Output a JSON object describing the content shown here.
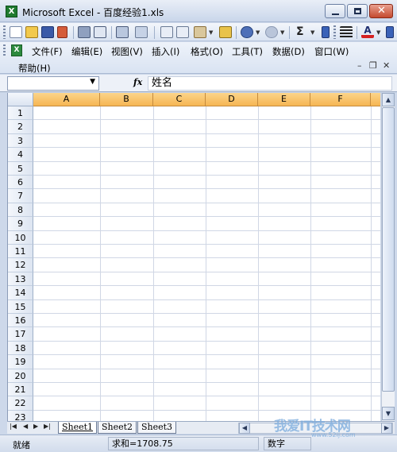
{
  "window": {
    "title": "Microsoft Excel - 百度经验1.xls",
    "app_icon_glyph": "X"
  },
  "menu": {
    "items": [
      {
        "label": "文件(F)"
      },
      {
        "label": "编辑(E)"
      },
      {
        "label": "视图(V)"
      },
      {
        "label": "插入(I)"
      },
      {
        "label": "格式(O)"
      },
      {
        "label": "工具(T)"
      },
      {
        "label": "数据(D)"
      },
      {
        "label": "窗口(W)"
      }
    ],
    "help": "帮助(H)"
  },
  "formula_bar": {
    "name_box": "",
    "fx_label": "fx",
    "content": "姓名"
  },
  "grid": {
    "columns": [
      "A",
      "B",
      "C",
      "D",
      "E",
      "F"
    ],
    "rows": [
      "1",
      "2",
      "3",
      "4",
      "5",
      "6",
      "7",
      "8",
      "9",
      "10",
      "11",
      "12",
      "13",
      "14",
      "15",
      "16",
      "17",
      "18",
      "19",
      "20",
      "21",
      "22",
      "23"
    ],
    "header_highlight_color": "#f6b653"
  },
  "sheets": {
    "tabs": [
      "Sheet1",
      "Sheet2",
      "Sheet3"
    ],
    "active": "Sheet1"
  },
  "status": {
    "ready": "就绪",
    "sum": "求和=1708.75",
    "mode": "数字"
  },
  "watermark": {
    "text": "我爱IT技术网",
    "url": "www.52ij.com"
  },
  "icons": {
    "toolbar": [
      "new-icon",
      "open-icon",
      "save-icon",
      "permission-icon",
      "print-icon",
      "print-preview-icon",
      "spelling-icon",
      "cut-icon",
      "copy-icon",
      "paste-icon",
      "format-painter-icon",
      "undo-icon",
      "redo-icon",
      "autosum-icon",
      "align-left-icon",
      "font-color-icon"
    ]
  }
}
